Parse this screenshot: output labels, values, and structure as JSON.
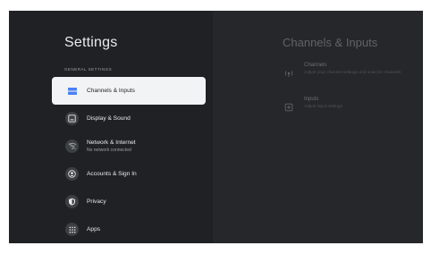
{
  "settings": {
    "title": "Settings",
    "section_label": "General Settings",
    "items": [
      {
        "label": "Channels & Inputs",
        "sub": "",
        "icon": "channels-inputs-icon",
        "selected": true
      },
      {
        "label": "Display & Sound",
        "sub": "",
        "icon": "display-icon",
        "selected": false
      },
      {
        "label": "Network & Internet",
        "sub": "No network connected",
        "icon": "wifi-off-icon",
        "selected": false
      },
      {
        "label": "Accounts & Sign In",
        "sub": "",
        "icon": "account-icon",
        "selected": false
      },
      {
        "label": "Privacy",
        "sub": "",
        "icon": "shield-icon",
        "selected": false
      },
      {
        "label": "Apps",
        "sub": "",
        "icon": "apps-grid-icon",
        "selected": false
      }
    ]
  },
  "detail": {
    "title": "Channels & Inputs",
    "entries": [
      {
        "name": "Channels",
        "desc": "Adjust your channel settings and scan for channels",
        "icon": "antenna-icon"
      },
      {
        "name": "Inputs",
        "desc": "Adjust input settings",
        "icon": "input-icon"
      }
    ]
  },
  "colors": {
    "background": "#202124",
    "panel_right": "#26272a",
    "selected_bg": "#f1f3f4",
    "accent_blue": "#4a80f5"
  }
}
